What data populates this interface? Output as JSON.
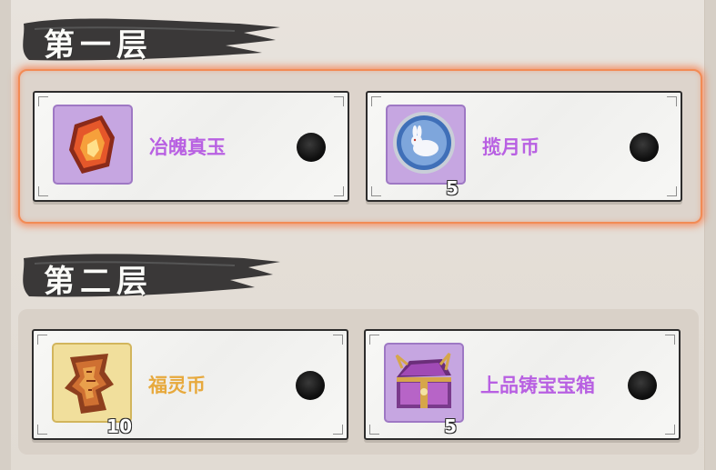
{
  "tiers": [
    {
      "title": "第一层",
      "selected": true,
      "rewards": [
        {
          "name": "冶魄真玉",
          "quantity": "",
          "icon": "fire-jade-icon",
          "rarity_color": "#c6a6e1",
          "name_color": "#b860e2"
        },
        {
          "name": "揽月币",
          "quantity": "5",
          "icon": "moon-rabbit-coin-icon",
          "rarity_color": "#c6a6e1",
          "name_color": "#b860e2"
        }
      ]
    },
    {
      "title": "第二层",
      "selected": false,
      "rewards": [
        {
          "name": "福灵币",
          "quantity": "10",
          "icon": "bronze-fortune-token-icon",
          "rarity_color": "#f1df9c",
          "name_color": "#e7a93d"
        },
        {
          "name": "上品铸宝宝箱",
          "quantity": "5",
          "icon": "treasure-chest-icon",
          "rarity_color": "#c6a6e1",
          "name_color": "#b860e2"
        }
      ]
    }
  ],
  "colors": {
    "selected_glow": "#f67c4a",
    "card_border": "#2d2c2c",
    "background": "#e4ded7"
  }
}
